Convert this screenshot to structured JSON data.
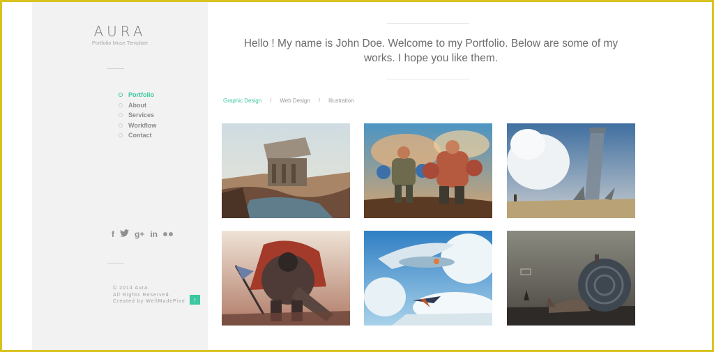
{
  "sidebar": {
    "logo": "AURA",
    "tagline": "Portfolio Muse Template",
    "nav": [
      {
        "label": "Portfolio",
        "active": true
      },
      {
        "label": "About",
        "active": false
      },
      {
        "label": "Services",
        "active": false
      },
      {
        "label": "Workflow",
        "active": false
      },
      {
        "label": "Contact",
        "active": false
      }
    ],
    "social": {
      "facebook": "f",
      "google_plus": "g+",
      "linkedin": "in"
    },
    "footer": {
      "copyright": "© 2014 Aura.",
      "rights": "All Rights Reserved.",
      "credit": "Created by WellMadePixe",
      "to_top": "↑"
    }
  },
  "main": {
    "welcome": "Hello ! My name is John Doe. Welcome to my Portfolio. Below are some of my works. I hope you like them.",
    "filters": {
      "graphic": "Graphic Design",
      "web": "Web Design",
      "illustration": "Illustration",
      "separator": "/"
    }
  },
  "colors": {
    "accent": "#3cc8a0",
    "border": "#d9c21f",
    "sidebar_bg": "#f2f2f2"
  }
}
